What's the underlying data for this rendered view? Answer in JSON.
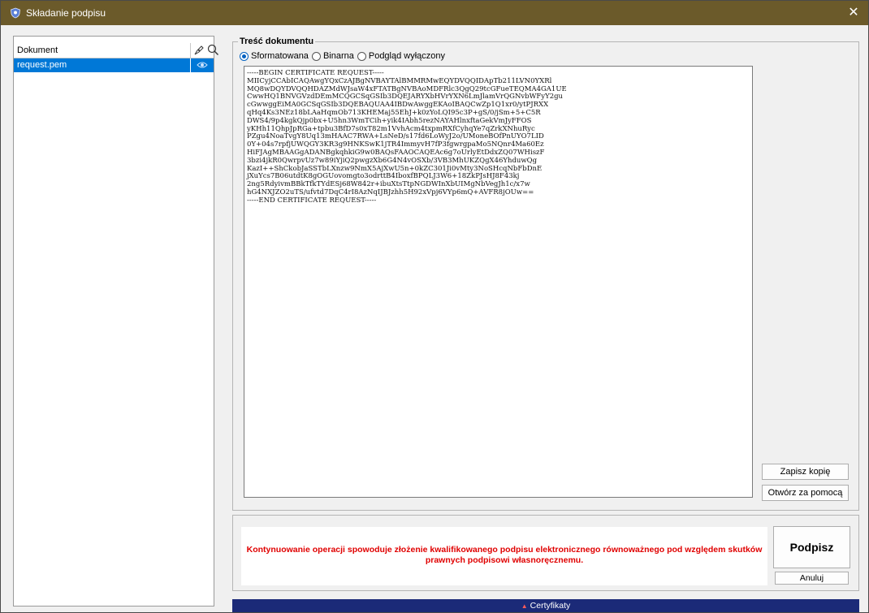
{
  "window": {
    "title": "Składanie podpisu"
  },
  "document_list": {
    "column_header": "Dokument",
    "items": [
      {
        "name": "request.pem"
      }
    ]
  },
  "content": {
    "group_title": "Treść dokumentu",
    "view_modes": [
      {
        "label": "Sformatowana",
        "selected": true
      },
      {
        "label": "Binarna",
        "selected": false
      },
      {
        "label": "Podgląd wyłączony",
        "selected": false
      }
    ],
    "lines": [
      "-----BEGIN CERTIFICATE REQUEST-----",
      "MIICyjCCAbICAQAwgYQxCzAJBgNVBAYTAlBMMRMwEQYDVQQIDApTb211LVN0YXRl",
      "MQ8wDQYDVQQHDAZMdWJsaW4xFTATBgNVBAoMDFRlc3QgQ29tcGFueTEQMA4GA1UE",
      "CwwHQ1BNVGVzdDEmMCQGCSqGSIb3DQEJARYXbHVrYXN6LmJlamVrQGNvbWFyY2gu",
      "cGwwggEiMA0GCSqGSIb3DQEBAQUAA4IBDwAwggEKAoIBAQCwZp1Q1xr0/ytPJRXX",
      "qHq4Ks3NEz18bLAaHqmOb713KHEMaj55EhJ+k0zYoLQI95c3P+gS/0/jSm+5+C5R",
      "DWS4/9p4kgkQjp0bx+U5hn3WmTCih+yik4IAbh5rezNAYAHlnxftaGekVmJyFFOS",
      "yKHh11QhpJpRGa+tpbu3BfD7s0xT82m1VvhAcm4txpmRXfCyhqYe7qZrkXNhuRyc",
      "PZgu4NoaTvgY8Uq13mHAAC7RWA+LsNeD/s17fd6LoWyJ2o/UMoneBOfPnUYO7LID",
      "0Y+04s7rpfjUWQGY3KR3g9HNKSwK1jTR4ImmyvH7fP3fgwrgpaMo5NQnr4Ma60Ez",
      "HiFJAgMBAAGgADANBgkqhkiG9w0BAQsFAAOCAQEAc6g7oUrlyEtDdxZQ07WHiszF",
      "3bzi4jkR0QwrpvUz7w89iYjiQ2pwgzXb6G4N4vOSXb/3VB3MhUKZQgX46YhduwQg",
      "KazI++ShCkobJaSSTbLXnzw9NmX5AjXwU5n+0kZC301Ji0vMty3NoSHcqNbFbDnE",
      "jXuYcs7B06utdtK8gOGUovomgto3odrttB4IboxfBPQLJ3W6+18ZkPJsHJ8F43kj",
      "2ng5RdyivmBBkTfkTYdESj68W842r+ibuXtsTtpNGDWInXbUIMgNbVegJh1c/x7w",
      "hG4NXJZO2uTS/ufvtd7DqC4rI8AzNqIJBJzhh5H92xVpj6VYp6mQ+AVFR8jOUw==",
      "-----END CERTIFICATE REQUEST-----"
    ],
    "save_copy_label": "Zapisz kopię",
    "open_with_label": "Otwórz za pomocą"
  },
  "signing": {
    "warning": "Kontynuowanie operacji spowoduje złożenie kwalifikowanego podpisu elektronicznego równoważnego pod względem skutków prawnych podpisowi własnoręcznemu.",
    "sign_label": "Podpisz",
    "cancel_label": "Anuluj"
  },
  "statusbar": {
    "label": "Certyfikaty"
  },
  "colors": {
    "titlebar": "#6b5a2a",
    "selection": "#0078d7",
    "warning": "#e00000",
    "statusbar": "#1b2a78"
  }
}
